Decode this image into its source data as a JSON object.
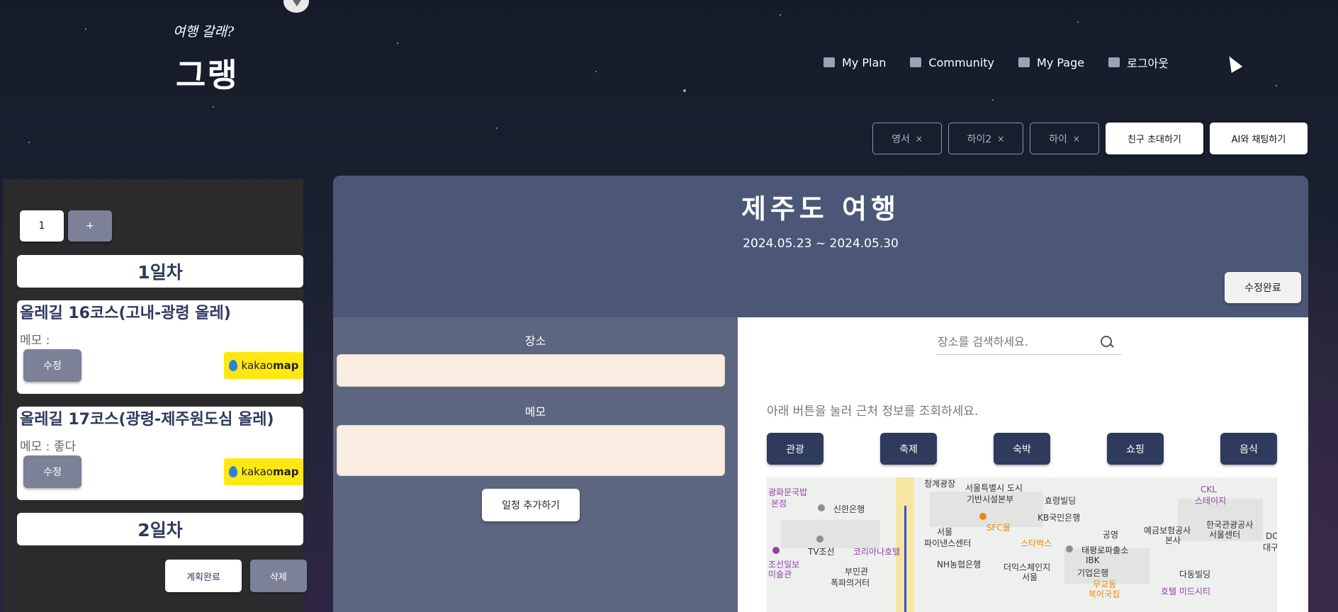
{
  "brand": {
    "subtitle": "여행 갈래?",
    "title": "그랭"
  },
  "nav": [
    {
      "label": "My Plan",
      "icon": "dashboard-icon"
    },
    {
      "label": "Community",
      "icon": "laptop-icon"
    },
    {
      "label": "My Page",
      "icon": "document-icon"
    },
    {
      "label": "로그아웃",
      "icon": "document-icon"
    }
  ],
  "friends": [
    {
      "name": "영서",
      "remove": "×"
    },
    {
      "name": "하이2",
      "remove": "×"
    },
    {
      "name": "하이",
      "remove": "×"
    }
  ],
  "actions": {
    "invite": "친구 초대하기",
    "ai_chat": "AI와 채팅하기"
  },
  "sidebar": {
    "day_tabs": [
      "1",
      "+"
    ],
    "days": [
      {
        "header": "1일차",
        "items": [
          {
            "title": "올레길 16코스(고내-광령 올레)",
            "memo": "메모 :",
            "edit": "수정",
            "map_label_a": "kakao",
            "map_label_b": "map"
          },
          {
            "title": "올레길 17코스(광령-제주원도심 올레)",
            "memo": "메모 : 좋다",
            "edit": "수정",
            "map_label_a": "kakao",
            "map_label_b": "map"
          }
        ]
      },
      {
        "header": "2일차",
        "items": []
      }
    ],
    "complete": "계획완료",
    "delete": "삭제"
  },
  "trip": {
    "title": "제주도 여행",
    "dates": "2024.05.23 ~ 2024.05.30",
    "edit_done": "수정완료"
  },
  "form": {
    "place_label": "장소",
    "memo_label": "메모",
    "add_button": "일정 추가하기"
  },
  "map_panel": {
    "search_placeholder": "장소를 검색하세요.",
    "hint": "아래 버튼을 눌러 근처 정보를 조회하세요.",
    "categories": [
      "관광",
      "축제",
      "숙박",
      "쇼핑",
      "음식"
    ],
    "labels": {
      "l1": "광화문국밥",
      "l2": "본점",
      "l3": "신한은행",
      "l4": "청계광장",
      "l5": "서울특별시 도시",
      "l6": "기반시설본부",
      "l7": "효령빌딩",
      "l8": "CKL",
      "l9": "스테이지",
      "l10": "SFC몰",
      "l11": "KB국민은행",
      "l12": "서울",
      "l13": "파이낸스센터",
      "l14": "공영",
      "l15": "예금보험공사",
      "l16": "본사",
      "l17": "한국관광공사",
      "l18": "서울센터",
      "l19": "TV조선",
      "l20": "코리아나호텔",
      "l21": "스타벅스",
      "l22": "태평로파출소",
      "l23": "NH농협은행",
      "l24": "더익스체인지",
      "l25": "서울",
      "l26": "IBK",
      "l27": "기업은행",
      "l28": "다동빌딩",
      "l29": "부민관",
      "l30": "폭파의거터",
      "l31": "조선일보",
      "l32": "미술관",
      "l33": "무교동",
      "l34": "북어국집",
      "l35": "호텔 미드시티",
      "l36": "DC",
      "l37": "대구"
    }
  }
}
